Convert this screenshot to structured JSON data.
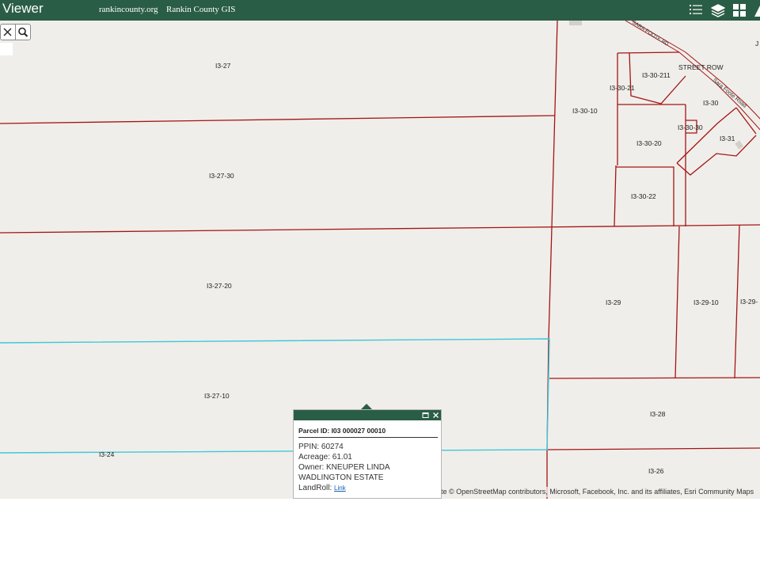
{
  "header": {
    "title": "Viewer",
    "links": [
      "rankincounty.org",
      "Rankin County GIS"
    ],
    "icons": [
      "list-icon",
      "layers-icon",
      "grid-icon",
      "triangle-icon"
    ],
    "color": "#2a5d45"
  },
  "map": {
    "background": "#f0eeea",
    "parcel_line_color": "#a31515",
    "selected_line_color": "#3ec8d8",
    "tools": [
      "close-icon",
      "search-icon"
    ],
    "parcel_labels": [
      "I3-27",
      "I3-27-30",
      "I3-27-20",
      "I3-27-10",
      "I3-24",
      "I3-30-10",
      "I3-30-211",
      "I3-30-21",
      "STREET ROW",
      "I3-30",
      "I3-30-30",
      "I3-31",
      "I3-30-20",
      "I3-30-22",
      "I3-29",
      "I3-29-10",
      "I3-29-",
      "I3-28",
      "I3-26",
      "J"
    ],
    "road_labels": [
      "SARA-FOOTE RD",
      "Sara Foote Road"
    ],
    "attribution": "te © OpenStreetMap contributors, Microsoft, Facebook, Inc. and its affiliates, Esri Community Maps"
  },
  "popup": {
    "title": "Parcel ID: I03 000027 00010",
    "ppin": "PPIN: 60274",
    "acreage": "Acreage: 61.01",
    "owner": "Owner: KNEUPER LINDA",
    "owner2": "WADLINGTON ESTATE",
    "landroll_label": "LandRoll:",
    "landroll_link": "Link"
  }
}
